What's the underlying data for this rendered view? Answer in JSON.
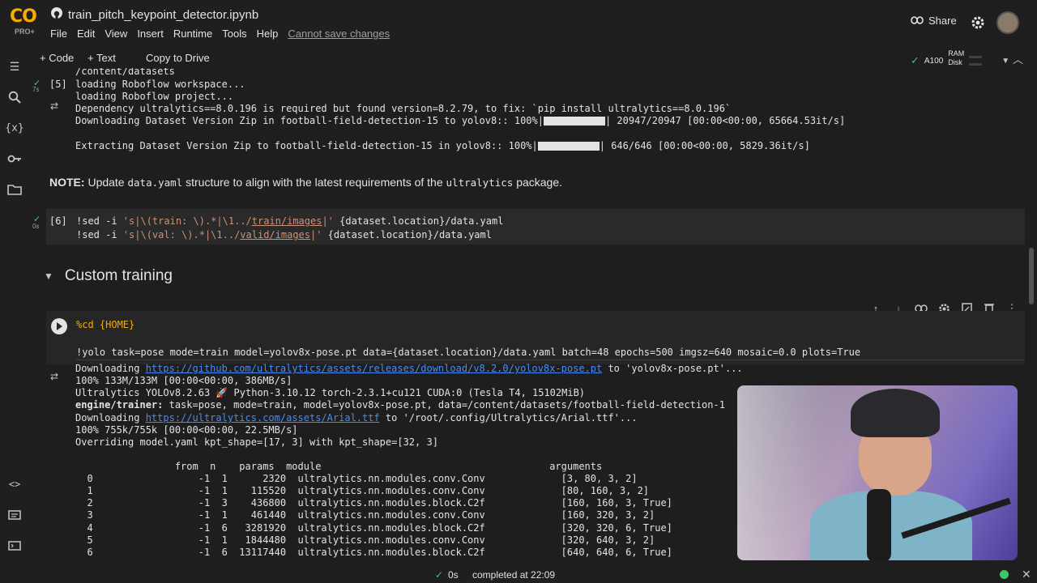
{
  "header": {
    "logo_text": "CO",
    "logo_badge": "PRO+",
    "title": "train_pitch_keypoint_detector.ipynb",
    "menu": [
      "File",
      "Edit",
      "View",
      "Insert",
      "Runtime",
      "Tools",
      "Help"
    ],
    "save_warning": "Cannot save changes",
    "share_label": "Share"
  },
  "toolbar": {
    "code_label": "+ Code",
    "text_label": "+ Text",
    "copy_label": "Copy to Drive",
    "gpu": "A100",
    "ram_label": "RAM",
    "disk_label": "Disk"
  },
  "cell5": {
    "number": "[5]",
    "time": "7s",
    "lines": {
      "l0": "/content/datasets",
      "l1": "loading Roboflow workspace...",
      "l2": "loading Roboflow project...",
      "l3": "Dependency ultralytics==8.0.196 is required but found version=8.2.79, to fix: `pip install ultralytics==8.0.196`",
      "l4a": "Downloading Dataset Version Zip in football-field-detection-15 to yolov8:: 100%|",
      "l4b": "| 20947/20947 [00:00<00:00, 65664.53it/s]",
      "l5a": "Extracting Dataset Version Zip to football-field-detection-15 in yolov8:: 100%|",
      "l5b": "| 646/646 [00:00<00:00, 5829.36it/s]"
    }
  },
  "note": {
    "bold": "NOTE:",
    "t1": " Update ",
    "c1": "data.yaml",
    "t2": " structure to align with the latest requirements of the ",
    "c2": "ultralytics",
    "t3": " package."
  },
  "cell6": {
    "number": "[6]",
    "time": "0s",
    "l1a": "!sed -i ",
    "l1b": "'s|\\(train: \\).*|\\1../",
    "l1c": "train/images",
    "l1d": "|'",
    "l1e": " {dataset.location}/data.yaml",
    "l2a": "!sed -i ",
    "l2b": "'s|\\(val: \\).*|\\1../",
    "l2c": "valid/images",
    "l2d": "|'",
    "l2e": " {dataset.location}/data.yaml"
  },
  "section": {
    "title": "Custom training"
  },
  "cell7": {
    "line1": "%cd {HOME}",
    "line2": "!yolo task=pose mode=train model=yolov8x-pose.pt data={dataset.location}/data.yaml batch=48 epochs=500 imgsz=640 mosaic=0.0 plots=True"
  },
  "output7": {
    "o0a": "Downloading ",
    "o0link": "https://github.com/ultralytics/assets/releases/download/v8.2.0/yolov8x-pose.pt",
    "o0b": " to 'yolov8x-pose.pt'...",
    "o1": "100% 133M/133M [00:00<00:00, 386MB/s]",
    "o2": "Ultralytics YOLOv8.2.63 🚀 Python-3.10.12 torch-2.3.1+cu121 CUDA:0 (Tesla T4, 15102MiB)",
    "o3a": "engine/trainer:",
    "o3b": " task=pose, mode=train, model=yolov8x-pose.pt, data=/content/datasets/football-field-detection-1",
    "o4a": "Downloading ",
    "o4link": "https://ultralytics.com/assets/Arial.ttf",
    "o4b": " to '/root/.config/Ultralytics/Arial.ttf'...",
    "o5": "100% 755k/755k [00:00<00:00, 22.5MB/s]",
    "o6": "Overriding model.yaml kpt_shape=[17, 3] with kpt_shape=[32, 3]",
    "table_header": "                 from  n    params  module                                       arguments",
    "rows": [
      "  0                  -1  1      2320  ultralytics.nn.modules.conv.Conv             [3, 80, 3, 2]",
      "  1                  -1  1    115520  ultralytics.nn.modules.conv.Conv             [80, 160, 3, 2]",
      "  2                  -1  3    436800  ultralytics.nn.modules.block.C2f             [160, 160, 3, True]",
      "  3                  -1  1    461440  ultralytics.nn.modules.conv.Conv             [160, 320, 3, 2]",
      "  4                  -1  6   3281920  ultralytics.nn.modules.block.C2f             [320, 320, 6, True]",
      "  5                  -1  1   1844480  ultralytics.nn.modules.conv.Conv             [320, 640, 3, 2]",
      "  6                  -1  6  13117440  ultralytics.nn.modules.block.C2f             [640, 640, 6, True]"
    ]
  },
  "status": {
    "check": "✓",
    "seconds": "0s",
    "completed": "completed at 22:09"
  }
}
